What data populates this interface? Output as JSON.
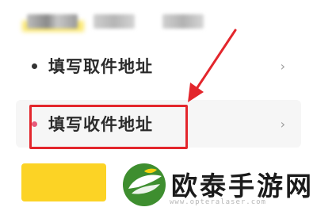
{
  "menu": {
    "items": [
      {
        "label": "填写取件地址",
        "chevron": "›"
      },
      {
        "label": "填写收件地址",
        "chevron": "›"
      }
    ]
  },
  "watermark": {
    "brand": "欧泰手游网",
    "url": "www.opteralaser.com"
  },
  "colors": {
    "highlight": "#e3262c",
    "accent_yellow": "#fcd325",
    "logo_green": "#3e8e2f"
  },
  "icons": [
    "chevron-right-icon",
    "bullet-dot-icon",
    "pointer-arrow-icon",
    "leaf-logo-icon"
  ]
}
